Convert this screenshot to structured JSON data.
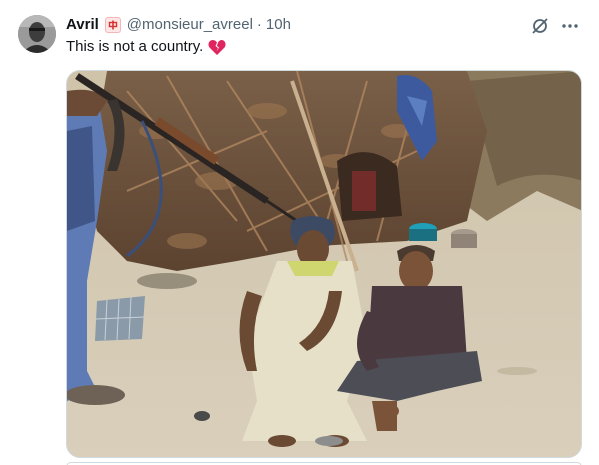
{
  "tweet": {
    "author": {
      "display_name": "Avril",
      "badge_icon": "flag-emoji-icon",
      "handle": "@monsieur_avreel",
      "separator": "·",
      "timestamp": "10h"
    },
    "text": "This is not a country.",
    "text_emoji": "broken-heart-icon",
    "actions": [
      "grok-icon",
      "more-icon"
    ],
    "colors": {
      "text": "#0f1419",
      "secondary": "#536471",
      "border": "#cfd9de",
      "broken_heart": "#e0245e"
    }
  }
}
